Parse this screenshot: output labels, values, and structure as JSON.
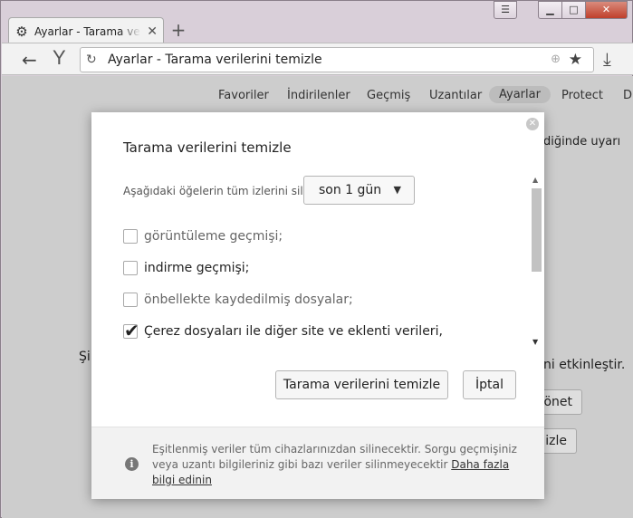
{
  "browser": {
    "tab_title": "Ayarlar - Tarama verilerini temizle",
    "address_text": "Ayarlar - Tarama verilerini temizle",
    "icons": [
      "gear-icon",
      "close-icon",
      "plus-icon",
      "menu-icon",
      "minimize-icon",
      "maximize-icon",
      "window-close-icon",
      "back-icon",
      "yandex-logo-icon",
      "reload-icon",
      "globe-icon",
      "star-icon",
      "download-icon"
    ]
  },
  "settings_nav": {
    "items": [
      "Favoriler",
      "İndirilenler",
      "Geçmiş",
      "Uzantılar",
      "Ayarlar",
      "Protect",
      "D"
    ]
  },
  "background": {
    "text_right_top": "diğinde uyarı",
    "text_left_sy": "Şi",
    "text_right_enable": "ni etkinleştir.",
    "btn_manage": "önet",
    "btn_clear_partial": "izle"
  },
  "dialog": {
    "title": "Tarama verilerini temizle",
    "period_label": "Aşağıdaki öğelerin tüm izlerini sil:",
    "period_value": "son 1 gün",
    "options": [
      {
        "label": "görüntüleme geçmişi;",
        "checked": false
      },
      {
        "label": "indirme geçmişi;",
        "checked": false
      },
      {
        "label": "önbellekte kaydedilmiş dosyalar;",
        "checked": false
      },
      {
        "label": "Çerez dosyaları ile diğer site ve eklenti verileri,",
        "checked": true
      }
    ],
    "clear_button": "Tarama verilerini temizle",
    "cancel_button": "İptal",
    "footer_text": "Eşitlenmiş veriler tüm cihazlarınızdan silinecektir. Sorgu geçmişiniz veya uzantı bilgileriniz gibi bazı veriler silinmeyecektir ",
    "footer_link": "Daha fazla bilgi edinin"
  }
}
